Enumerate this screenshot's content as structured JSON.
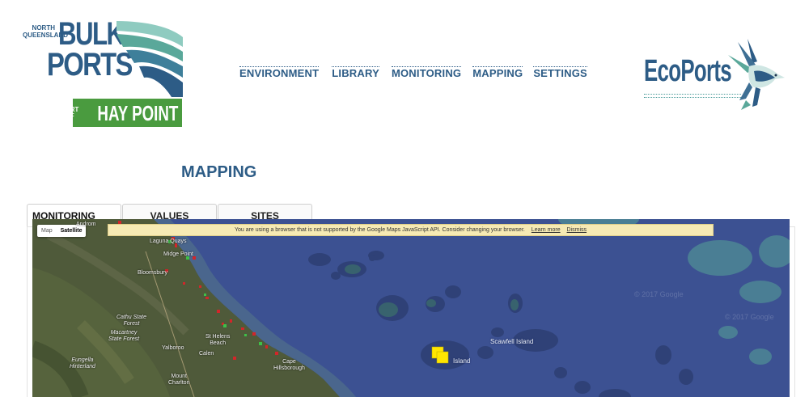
{
  "logo_left": {
    "north_queensland": "NORTH QUEENSLAND",
    "bulk": "BULK",
    "ports": "PORTS",
    "port_of": "PORT OF",
    "hay_point": "HAY POINT",
    "colors": {
      "blue": "#2d5c86",
      "green": "#4a9b3f",
      "teal": "#5aa89a"
    }
  },
  "nav": {
    "items": [
      "ENVIRONMENT",
      "LIBRARY",
      "MONITORING",
      "MAPPING",
      "SETTINGS"
    ]
  },
  "logo_right": {
    "text": "EcoPorts"
  },
  "page": {
    "title": "MAPPING"
  },
  "tabs": [
    "MONITORING DATA",
    "VALUES",
    "SITES"
  ],
  "map": {
    "type_controls": {
      "map": "Map",
      "satellite": "Satellite"
    },
    "banner": {
      "message": "You are using a browser that is not supported by the Google Maps JavaScript API. Consider changing your browser.",
      "learn_more": "Learn more",
      "dismiss": "Dismiss"
    },
    "labels": {
      "androm": "Androm",
      "laguna_quays": "Laguna Quays",
      "midge_point": "Midge Point",
      "bloomsbury": "Bloomsbury",
      "cathu_state_forest": "Cathu State\nForest",
      "macartney_state_forest": "Macartney\nState Forest",
      "st_helens_beach": "St Helens\nBeach",
      "yalboroo": "Yalboroo",
      "calen": "Calen",
      "eungella_hinterland": "Eungella\nHinterland",
      "mount_charlton": "Mount\nCharlton",
      "cape_hillsborough": "Cape\nHillsborough",
      "scawfell_island": "Scawfell Island",
      "island": "Island"
    },
    "watermark": "© 2017 Google",
    "marker_color": "#ffe600"
  }
}
